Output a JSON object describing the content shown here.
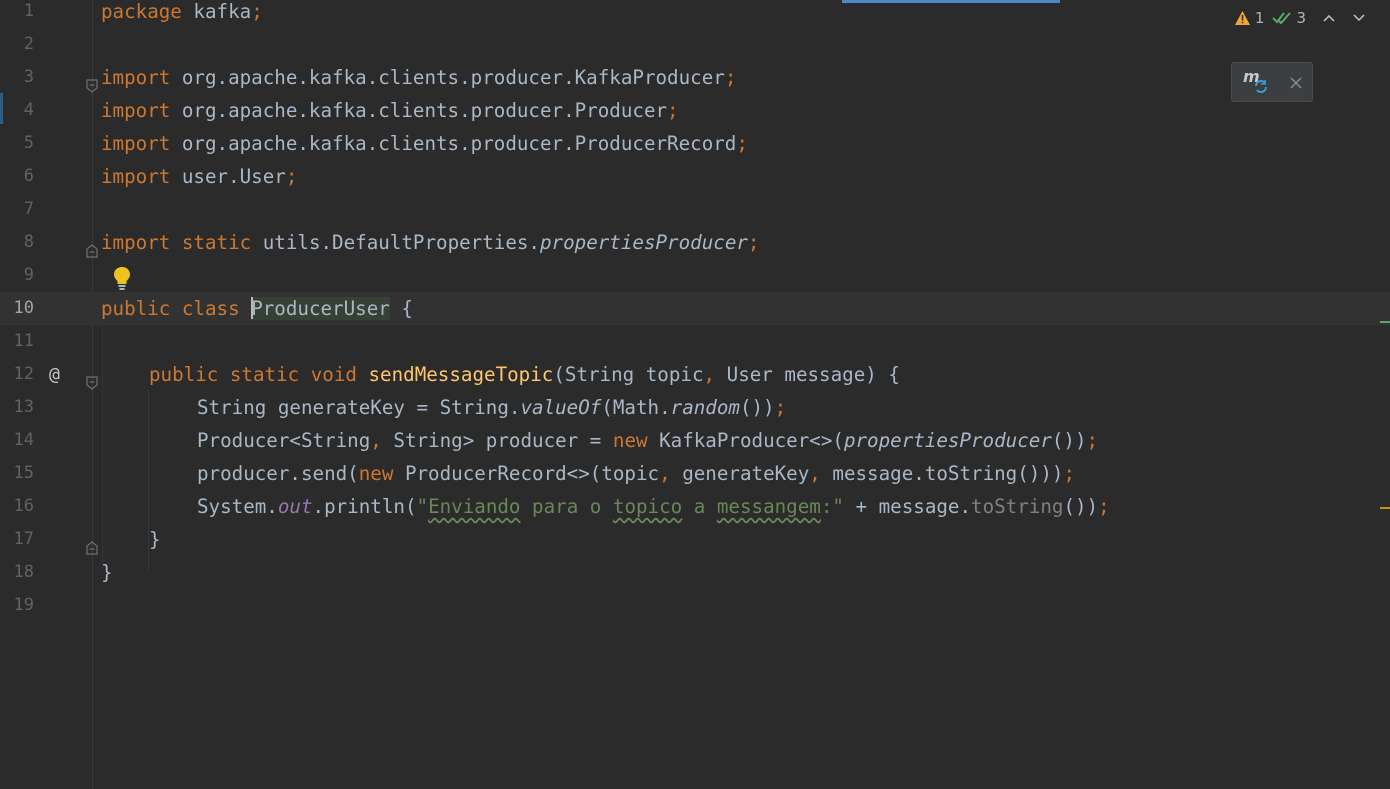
{
  "editor": {
    "line_numbers": [
      "1",
      "2",
      "3",
      "4",
      "5",
      "6",
      "7",
      "8",
      "9",
      "10",
      "11",
      "12",
      "13",
      "14",
      "15",
      "16",
      "17",
      "18",
      "19"
    ],
    "current_line": "10",
    "gutter_annotation": "@"
  },
  "inspections": {
    "warnings": "1",
    "ok": "3",
    "warning_icon": "warning-triangle-icon",
    "ok_icon": "double-check-icon"
  },
  "colors": {
    "background": "#2b2b2b",
    "keyword": "#cc7832",
    "function": "#ffc66d",
    "string": "#6a8759",
    "static_field": "#9876aa",
    "text": "#a9b7c6"
  },
  "code": {
    "l1": {
      "kw": "package",
      "name": " kafka",
      "semi": ";"
    },
    "l3": {
      "kw": "import",
      "name": " org.apache.kafka.clients.producer.KafkaProducer",
      "semi": ";"
    },
    "l4": {
      "kw": "import",
      "name": " org.apache.kafka.clients.producer.Producer",
      "semi": ";"
    },
    "l5": {
      "kw": "import",
      "name": " org.apache.kafka.clients.producer.ProducerRecord",
      "semi": ";"
    },
    "l6": {
      "kw": "import",
      "name": " user.User",
      "semi": ";"
    },
    "l8": {
      "kw": "import static",
      "name": " utils.DefaultProperties.",
      "member": "propertiesProducer",
      "semi": ";"
    },
    "l10": {
      "kw": "public class",
      "first_char": "P",
      "class_rest": "roducerUser",
      "brace": " {"
    },
    "l12": {
      "kw": "public static void",
      "fn": "sendMessageTopic",
      "a1": "(String topic",
      "comma": ",",
      "a2": " User message) {"
    },
    "l13": {
      "a": "String generateKey = String.",
      "m": "valueOf",
      "b": "(Math.",
      "m2": "random",
      "c": "())",
      "semi": ";"
    },
    "l14": {
      "a": "Producer<String",
      "comma": ",",
      "b": " String> producer = ",
      "kw": "new",
      "c": " KafkaProducer<>(",
      "m": "propertiesProducer",
      "d": "())",
      "semi": ";"
    },
    "l15": {
      "a": "producer.send(",
      "kw": "new",
      "b": " ProducerRecord<>(topic",
      "comma1": ",",
      "c": " generateKey",
      "comma2": ",",
      "d": " message.toString()))",
      "semi": ";"
    },
    "l16": {
      "a": "System.",
      "m": "out",
      "b": ".println(",
      "q1": "\"",
      "w1": "Enviando",
      "s1": " para o ",
      "w2": "topico",
      "s2": " a ",
      "w3": "messangem",
      "q2": ":\"",
      "c": " + message.",
      "m2": "toString",
      "d": "())",
      "semi": ";"
    },
    "l17": {
      "brace": "}"
    },
    "l18": {
      "brace": "}"
    }
  }
}
